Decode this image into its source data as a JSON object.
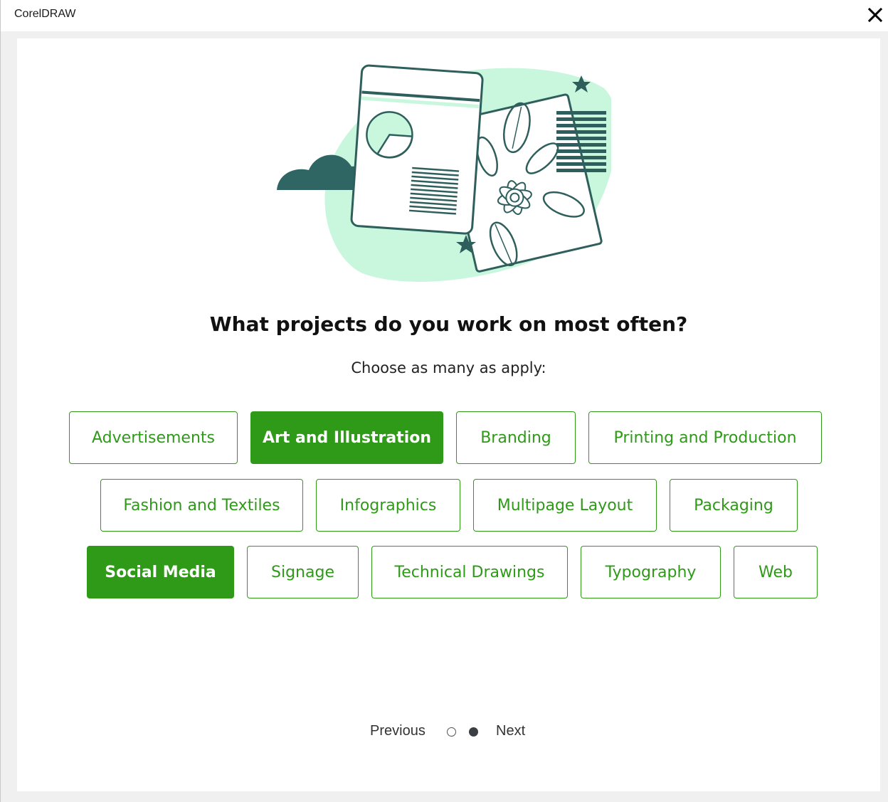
{
  "window": {
    "title": "CorelDRAW"
  },
  "question": {
    "heading": "What projects do you work on most often?",
    "subheading": "Choose as many as apply:"
  },
  "options": [
    {
      "label": "Advertisements",
      "selected": false
    },
    {
      "label": "Art and Illustration",
      "selected": true
    },
    {
      "label": "Branding",
      "selected": false
    },
    {
      "label": "Printing and Production",
      "selected": false
    },
    {
      "label": "Fashion and Textiles",
      "selected": false
    },
    {
      "label": "Infographics",
      "selected": false
    },
    {
      "label": "Multipage Layout",
      "selected": false
    },
    {
      "label": "Packaging",
      "selected": false
    },
    {
      "label": "Social Media",
      "selected": true
    },
    {
      "label": "Signage",
      "selected": false
    },
    {
      "label": "Technical Drawings",
      "selected": false
    },
    {
      "label": "Typography",
      "selected": false
    },
    {
      "label": "Web",
      "selected": false
    }
  ],
  "pager": {
    "previous_label": "Previous",
    "next_label": "Next",
    "page_count": 2,
    "current_page": 2
  },
  "colors": {
    "accent": "#2e9a18",
    "illustration_dark": "#2f5f5c",
    "illustration_mint": "#c9f7dd"
  }
}
